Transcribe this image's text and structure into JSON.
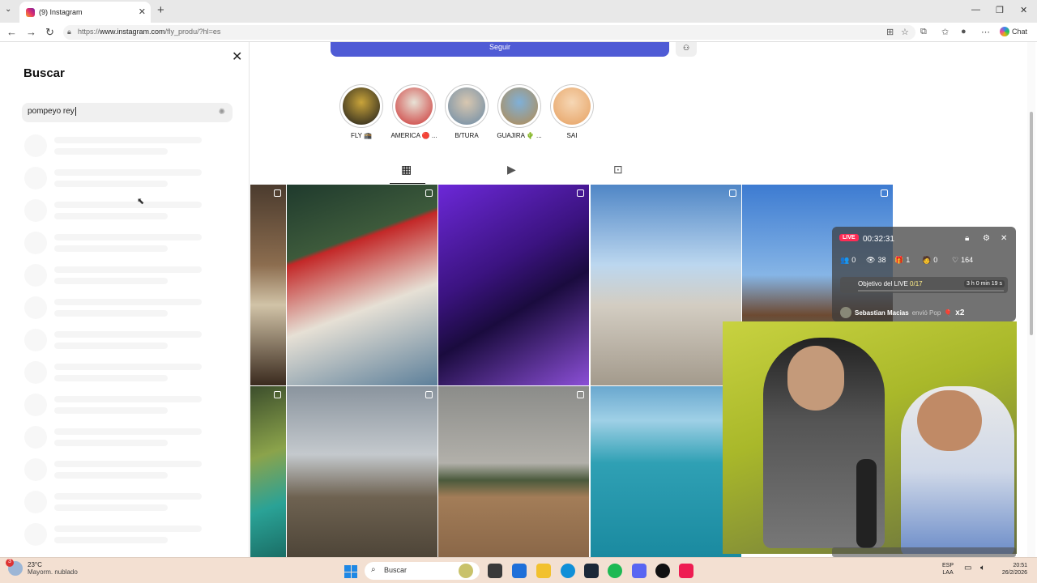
{
  "browser": {
    "tab_title": "(9) Instagram",
    "url_prefix": "https://",
    "url_main": "www.instagram.com",
    "url_rest": "/fly_produ/?hl=es",
    "chat_label": "Chat"
  },
  "search": {
    "title": "Buscar",
    "query": "pompeyo rey"
  },
  "profile": {
    "follow_label": "Seguir",
    "highlights": [
      {
        "label": "FLY 🕋",
        "colors": [
          "#1b1b1b",
          "#c9a43a"
        ]
      },
      {
        "label": "AMERICA 🔴 ...",
        "colors": [
          "#c33",
          "#e8e2d6"
        ]
      },
      {
        "label": "B/TURA",
        "colors": [
          "#6a8aa6",
          "#d8c7b0"
        ]
      },
      {
        "label": "GUAJIRA 🌵 ...",
        "colors": [
          "#b48a4e",
          "#7fb0d8"
        ]
      },
      {
        "label": "SAI",
        "colors": [
          "#e6a060",
          "#f6d7b5"
        ]
      }
    ],
    "tabs": [
      "posts-grid",
      "reels",
      "tagged"
    ]
  },
  "posts": [
    {
      "name": "post-sea-edge-1",
      "bg": "linear-gradient(180deg,#4b3b2e,#8c6d4f 40%,#d1c3a7 60%,#3a2a1e)"
    },
    {
      "name": "post-man-red-cap",
      "bg": "linear-gradient(160deg,#1f3a2d,#3d5a3b 30%,#c32828 32%,#e6e0d5 60%,#5c7f9a)"
    },
    {
      "name": "post-purple-selfie",
      "bg": "linear-gradient(150deg,#6c28d8,#3b1380 40%,#1a0b3e 60%,#8b4fd6)"
    },
    {
      "name": "post-man-on-rocks",
      "bg": "linear-gradient(180deg,#4f86c6,#bcd7ef 40%,#d3cdc2 60%,#a39a8c)"
    },
    {
      "name": "post-coast-cliff",
      "bg": "linear-gradient(180deg,#3d7bd1,#86b5e6 45%,#6d4a32 65%,#2ba6b8)"
    },
    {
      "name": "post-sea-edge-2",
      "bg": "linear-gradient(160deg,#3c4e2c,#8ba34b 40%,#2aa296 70%,#1a6e66)"
    },
    {
      "name": "post-quad-bikes",
      "bg": "linear-gradient(180deg,#8a949e,#c4c9cd 40%,#6e6251 65%,#4e4538)"
    },
    {
      "name": "post-dry-plains",
      "bg": "linear-gradient(180deg,#8b8c89,#b2b0aa 45%,#4b5a3c 55%,#a37d58 65%,#8a6748)"
    },
    {
      "name": "post-jet-ski",
      "bg": "linear-gradient(180deg,#6aa8cf,#9fd0e6 20%,#2fa0b4 45%,#1a8aa0)"
    }
  ],
  "live": {
    "badge": "LIVE",
    "time": "00:32:31",
    "stats": [
      {
        "icon": "👥",
        "value": "0"
      },
      {
        "icon": "👁",
        "value": "38"
      },
      {
        "icon": "🎁",
        "value": "1"
      },
      {
        "icon": "🧑",
        "value": "0"
      },
      {
        "icon": "♡",
        "value": "164"
      }
    ],
    "goal_label": "Objetivo del LIVE",
    "goal_progress": "0/17",
    "goal_time_left": "3 h 0 min 19 s",
    "gift_user": "Sebastian Macias",
    "gift_msg": "envió Pop",
    "gift_count": "x2"
  },
  "taskbar": {
    "temperature": "23°C",
    "weather": "Mayorm. nublado",
    "weather_badge": "3",
    "search_placeholder": "Buscar",
    "lang1": "ESP",
    "lang2": "LAA",
    "time": "20:51",
    "date": "26/2/2026"
  }
}
